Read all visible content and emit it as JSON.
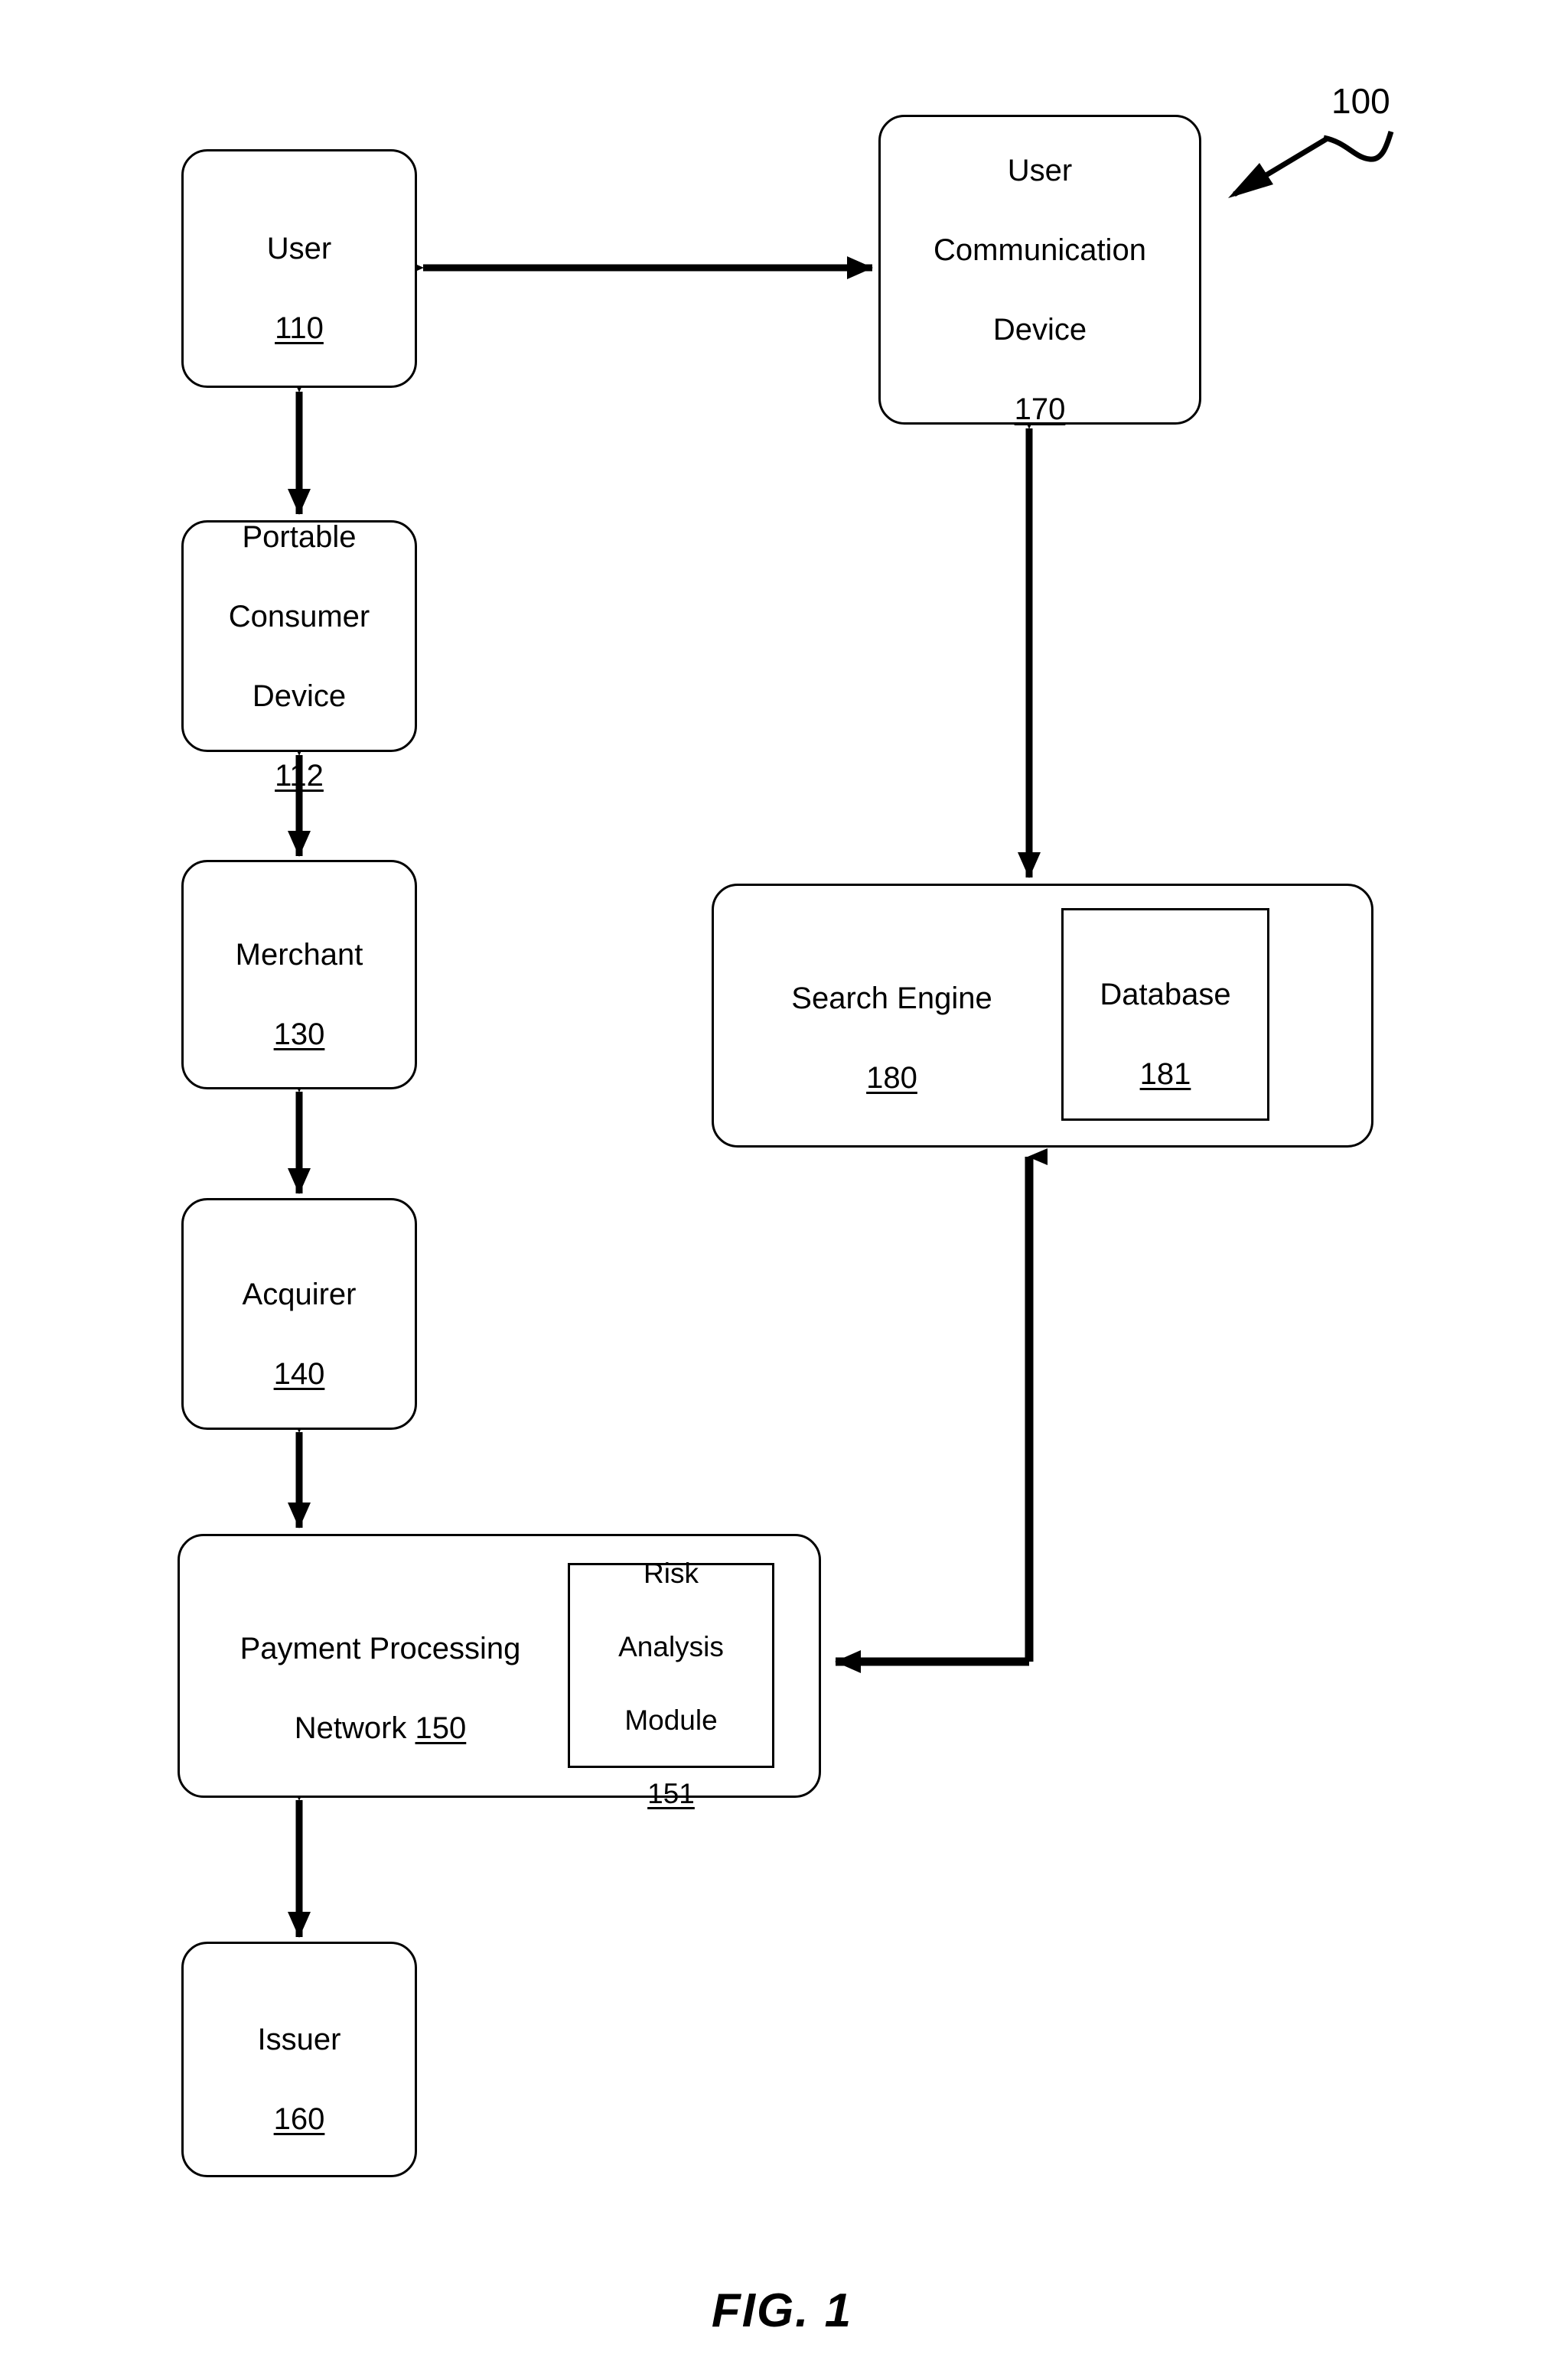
{
  "figure": {
    "caption": "FIG. 1",
    "system_reference": "100"
  },
  "nodes": [
    {
      "id": "user",
      "label": "User",
      "ref": "110",
      "text": "User\n110"
    },
    {
      "id": "portable-consumer-device",
      "label": "Portable Consumer Device",
      "ref": "112",
      "text": "Portable\nConsumer\nDevice\n112"
    },
    {
      "id": "merchant",
      "label": "Merchant",
      "ref": "130",
      "text": "Merchant\n130"
    },
    {
      "id": "acquirer",
      "label": "Acquirer",
      "ref": "140",
      "text": "Acquirer\n140"
    },
    {
      "id": "payment-processing-network",
      "label": "Payment Processing Network",
      "ref": "150",
      "text": "Payment Processing\nNetwork 150"
    },
    {
      "id": "risk-analysis-module",
      "label": "Risk Analysis Module",
      "ref": "151",
      "text": "Risk\nAnalysis\nModule\n151"
    },
    {
      "id": "issuer",
      "label": "Issuer",
      "ref": "160",
      "text": "Issuer\n160"
    },
    {
      "id": "user-communication-device",
      "label": "User Communication Device",
      "ref": "170",
      "text": "User\nCommunication\nDevice\n170"
    },
    {
      "id": "search-engine",
      "label": "Search Engine",
      "ref": "180",
      "text": "Search Engine\n180"
    },
    {
      "id": "database",
      "label": "Database",
      "ref": "181",
      "text": "Database\n181"
    }
  ],
  "connectors": [
    {
      "id": "user-to-pcd",
      "from": "user",
      "to": "portable-consumer-device",
      "style": "double-arrow-vertical"
    },
    {
      "id": "pcd-to-merchant",
      "from": "portable-consumer-device",
      "to": "merchant",
      "style": "double-arrow-vertical"
    },
    {
      "id": "merchant-to-acquirer",
      "from": "merchant",
      "to": "acquirer",
      "style": "double-arrow-vertical"
    },
    {
      "id": "acquirer-to-ppn",
      "from": "acquirer",
      "to": "payment-processing-network",
      "style": "double-arrow-vertical"
    },
    {
      "id": "ppn-to-issuer",
      "from": "payment-processing-network",
      "to": "issuer",
      "style": "double-arrow-vertical"
    },
    {
      "id": "user-to-ucd",
      "from": "user",
      "to": "user-communication-device",
      "style": "double-arrow-horizontal"
    },
    {
      "id": "ucd-to-search-engine",
      "from": "user-communication-device",
      "to": "search-engine",
      "style": "double-arrow-vertical"
    },
    {
      "id": "search-engine-to-ppn",
      "from": "search-engine",
      "to": "payment-processing-network",
      "style": "elbow-arrow-single"
    }
  ],
  "colors": {
    "stroke": "#000000",
    "background": "#ffffff"
  }
}
